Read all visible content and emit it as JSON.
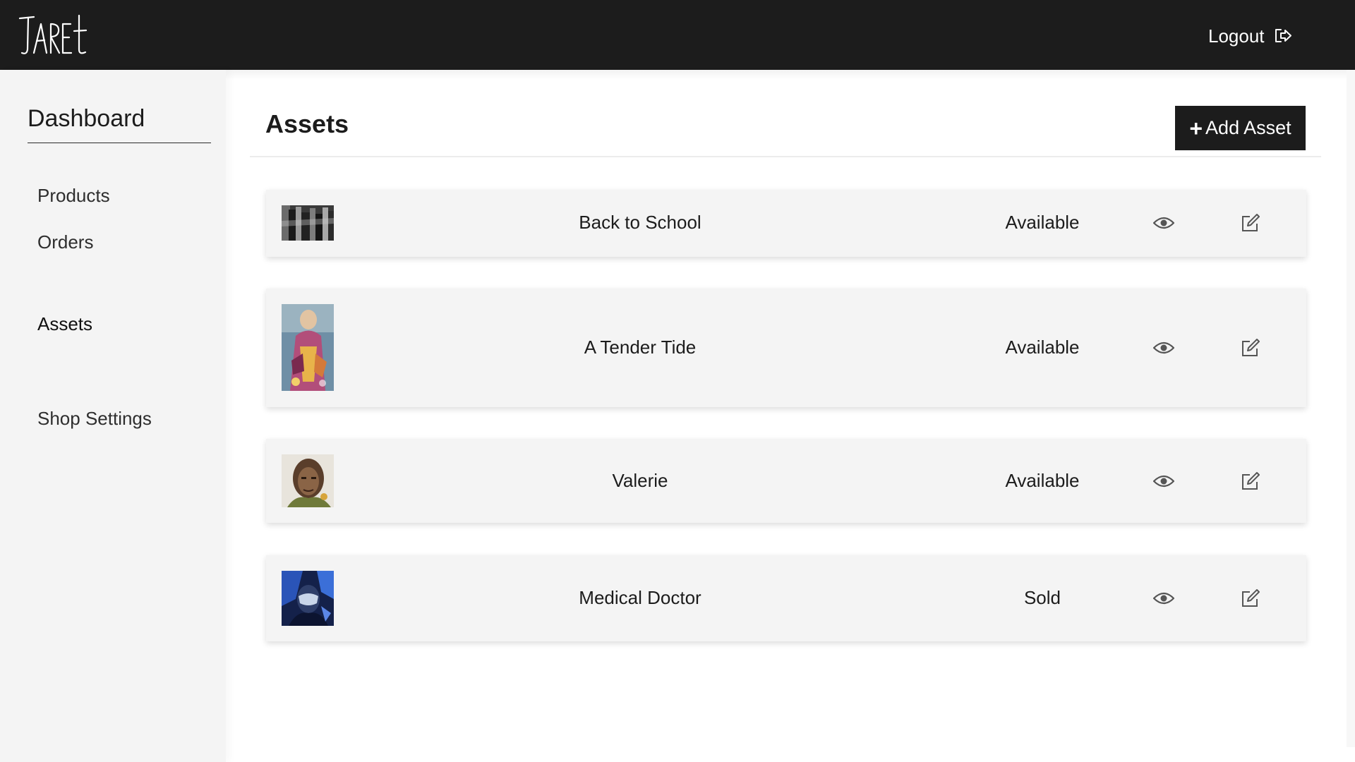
{
  "header": {
    "logo_text": "JARET",
    "logout_label": "Logout",
    "logout_icon": "sign-out-icon",
    "background_color": "#1c1c1c"
  },
  "sidebar": {
    "title": "Dashboard",
    "items": [
      {
        "label": "Products"
      },
      {
        "label": "Orders"
      },
      {
        "label": "Assets",
        "active": true
      },
      {
        "label": "Shop Settings"
      }
    ]
  },
  "main": {
    "title": "Assets",
    "add_button_label": "Add Asset",
    "add_button_icon": "plus-icon",
    "assets": [
      {
        "name": "Back to School",
        "status": "Available",
        "thumbnail": "black-and-white painting"
      },
      {
        "name": "A Tender Tide",
        "status": "Available",
        "thumbnail": "colorful portrait painting"
      },
      {
        "name": "Valerie",
        "status": "Available",
        "thumbnail": "portrait of a woman"
      },
      {
        "name": "Medical Doctor",
        "status": "Sold",
        "thumbnail": "blue portrait painting"
      }
    ],
    "row_actions": {
      "view_icon": "eye-icon",
      "edit_icon": "edit-icon"
    }
  }
}
